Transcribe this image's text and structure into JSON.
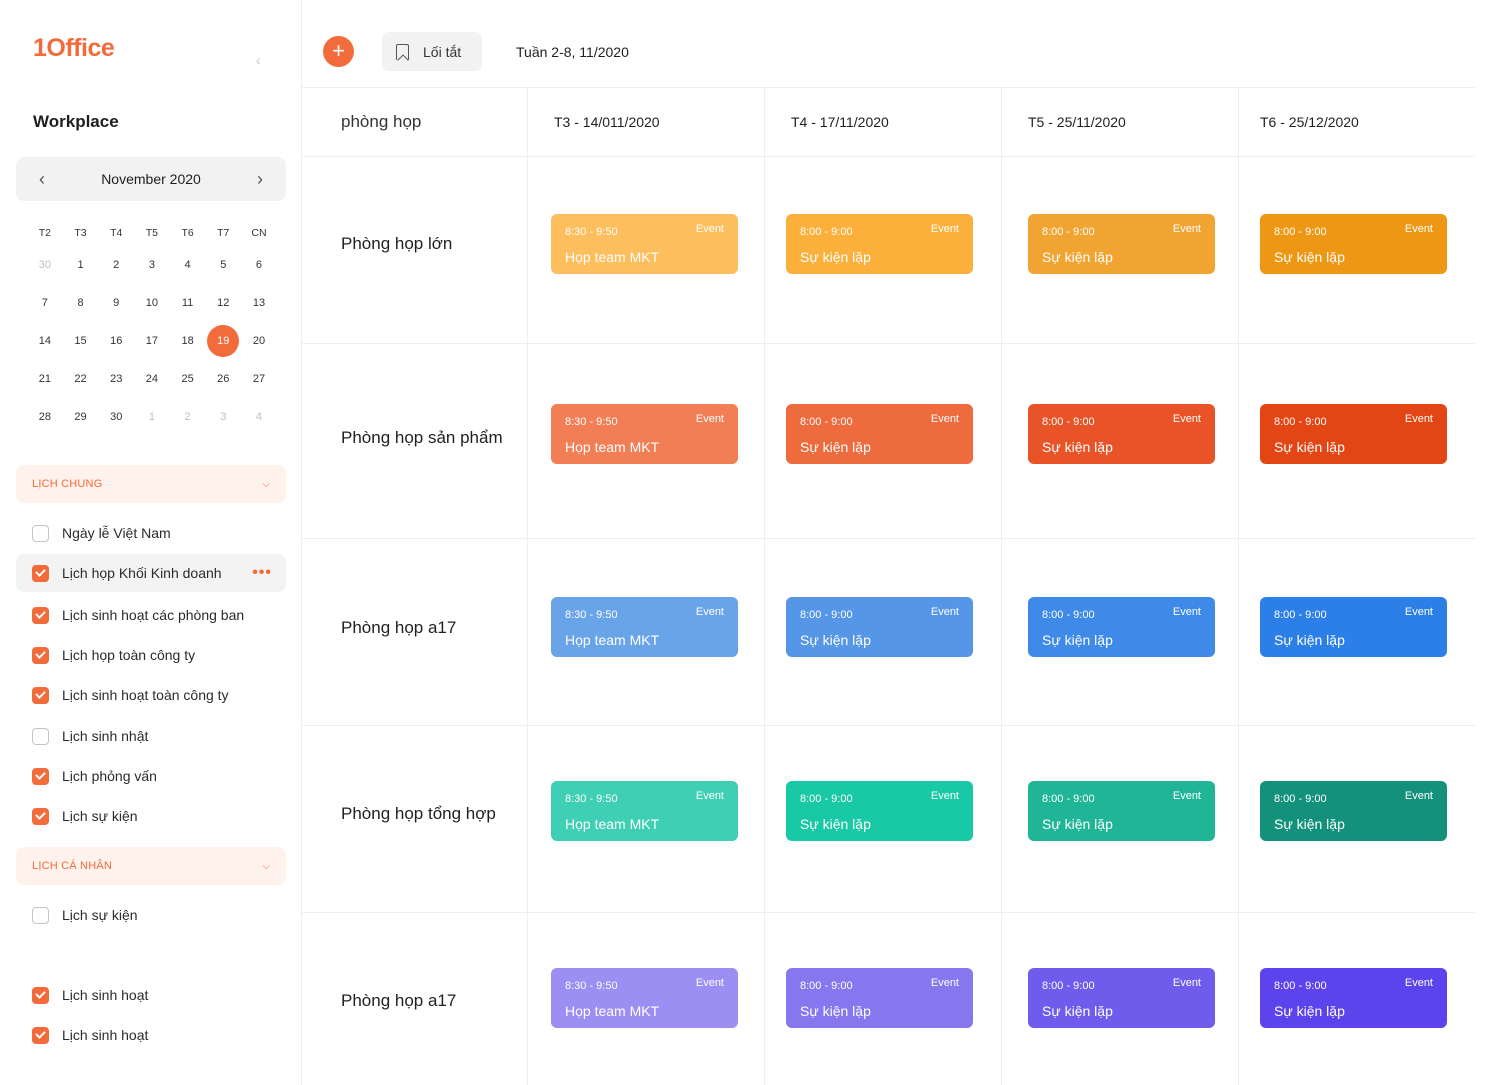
{
  "sidebar": {
    "logo": "1Office",
    "workplace": "Workplace",
    "month": "November 2020",
    "weekdays": [
      "T2",
      "T3",
      "T4",
      "T5",
      "T6",
      "T7",
      "CN"
    ],
    "weeks": [
      [
        "30",
        "1",
        "2",
        "3",
        "4",
        "5",
        "6"
      ],
      [
        "7",
        "8",
        "9",
        "10",
        "11",
        "12",
        "13"
      ],
      [
        "14",
        "15",
        "16",
        "17",
        "18",
        "19",
        "20"
      ],
      [
        "21",
        "22",
        "23",
        "24",
        "25",
        "26",
        "27"
      ],
      [
        "28",
        "29",
        "30",
        "1",
        "2",
        "3",
        "4"
      ]
    ],
    "today": "19",
    "sections": {
      "common": "LỊCH CHUNG",
      "personal": "LỊCH CÁ NHÂN"
    },
    "common_items": [
      {
        "label": "Ngày lễ Việt Nam",
        "checked": false
      },
      {
        "label": "Lịch họp Khối Kinh doanh",
        "checked": true,
        "active": true
      },
      {
        "label": "Lịch sinh hoạt các phòng ban",
        "checked": true
      },
      {
        "label": "Lịch họp toàn công ty",
        "checked": true
      },
      {
        "label": "Lịch sinh hoạt toàn công ty",
        "checked": true
      },
      {
        "label": "Lịch sinh nhật",
        "checked": false
      },
      {
        "label": "Lịch phỏng vấn",
        "checked": true
      },
      {
        "label": "Lịch sự kiện",
        "checked": true
      }
    ],
    "personal_items": [
      {
        "label": "Lịch sự kiện",
        "checked": false
      },
      {
        "label": "Lịch sinh hoạt",
        "checked": true
      },
      {
        "label": "Lịch sinh hoạt",
        "checked": true
      }
    ],
    "more_icon": "•••"
  },
  "topbar": {
    "add_icon": "+",
    "shortcut_label": "Lối tắt",
    "week_label": "Tuần 2-8, 11/2020"
  },
  "grid": {
    "room_header": "phòng họp",
    "days": [
      "T3 - 14/011/2020",
      "T4 - 17/11/2020",
      "T5 - 25/11/2020",
      "T6 - 25/12/2020"
    ],
    "rows": [
      {
        "room": "Phòng họp lớn",
        "colors": [
          "#fdbe5d",
          "#fbb03b",
          "#f2a433",
          "#ee9714"
        ]
      },
      {
        "room": "Phòng họp sản phẩm",
        "colors": [
          "#f17e55",
          "#ee6b3d",
          "#e85428",
          "#e34515"
        ]
      },
      {
        "room": "Phòng họp a17",
        "colors": [
          "#6aa4e8",
          "#5596e7",
          "#3f89e9",
          "#2d7fe8"
        ]
      },
      {
        "room": "Phòng họp tổng hợp",
        "colors": [
          "#3fcfb4",
          "#19c8a4",
          "#1fb596",
          "#14917b"
        ]
      },
      {
        "room": "Phòng họp a17",
        "colors": [
          "#9c8ef3",
          "#8777ef",
          "#6f5ced",
          "#5d43ec"
        ]
      }
    ],
    "first_event": {
      "time": "8:30 - 9:50",
      "title": "Họp team MKT",
      "tag": "Event"
    },
    "other_event": {
      "time": "8:00 - 9:00",
      "title": "Sự kiện lặp",
      "tag": "Event"
    }
  }
}
